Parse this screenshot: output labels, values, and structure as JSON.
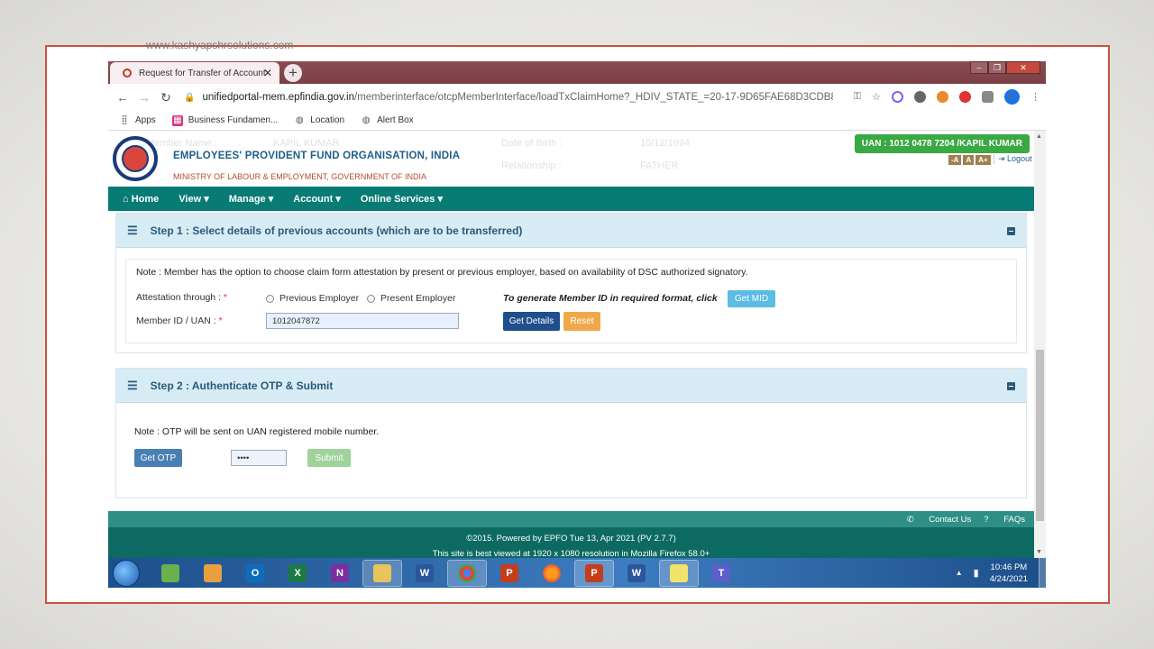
{
  "watermark": "www.kashyapshrsolutions.com",
  "browser": {
    "tab_title": "Request for Transfer of Account",
    "tab_close": "✕",
    "new_tab": "+",
    "url_host": "unifiedportal-mem.epfindia.gov.in",
    "url_path": "/memberinterface/otcpMemberInterface/loadTxClaimHome?_HDIV_STATE_=20-17-9D65FAE68D3CDB85ADB1...",
    "profile_initial": "k",
    "bookmarks": [
      "Apps",
      "Business Fundamen...",
      "Location",
      "Alert Box"
    ]
  },
  "header": {
    "ghost_fields": [
      "Member Name :",
      "KAPIL KUMAR",
      "Date of Birth :",
      "10/12/1994",
      "Relationship :",
      "FATHER"
    ],
    "org_name": "EMPLOYEES' PROVIDENT FUND ORGANISATION, INDIA",
    "ministry": "MINISTRY OF LABOUR & EMPLOYMENT, GOVERNMENT OF INDIA",
    "uan_badge": "UAN : 1012 0478 7204 /KAPIL KUMAR",
    "font_sizes": [
      "-A",
      "A",
      "A+"
    ],
    "logout": "Logout"
  },
  "nav": {
    "home": "Home",
    "view": "View ▾",
    "manage": "Manage ▾",
    "account": "Account ▾",
    "online_services": "Online Services ▾"
  },
  "step1": {
    "title": "Step 1 : Select details of previous accounts (which are to be transferred)",
    "note": "Note : Member has the option to choose claim form attestation by present or previous employer, based on availability of DSC authorized signatory.",
    "attestation_label": "Attestation through :",
    "required": "*",
    "option_previous": "Previous Employer",
    "option_present": "Present Employer",
    "generate_text": "To generate Member ID in required format, click",
    "get_mid": "Get MID",
    "member_id_label": "Member ID / UAN :",
    "member_id_value": "1012047872",
    "get_details": "Get Details",
    "reset": "Reset"
  },
  "step2": {
    "title": "Step 2 : Authenticate OTP & Submit",
    "note": "Note : OTP will be sent on UAN registered mobile number.",
    "get_otp": "Get OTP",
    "otp_value": "••••",
    "submit": "Submit"
  },
  "footer": {
    "contact_us": "Contact Us",
    "faqs": "FAQs",
    "line1": "©2015. Powered by EPFO Tue 13, Apr 2021 (PV 2.7.7)",
    "line2": "This site is best viewed at 1920 x 1080 resolution in Mozilla Firefox 58.0+"
  },
  "taskbar": {
    "apps": [
      "",
      "",
      "O",
      "X",
      "N",
      "",
      "W",
      "",
      "P",
      "",
      "P",
      "W",
      "",
      "T"
    ],
    "time": "10:46 PM",
    "date": "4/24/2021"
  },
  "colors": {
    "teal_nav": "#087c74",
    "uan_green": "#3aa843",
    "get_details_blue": "#1f4f8c",
    "reset_orange": "#f0a94a",
    "get_mid_blue": "#5bbce4",
    "frame_border": "#c5543b"
  }
}
